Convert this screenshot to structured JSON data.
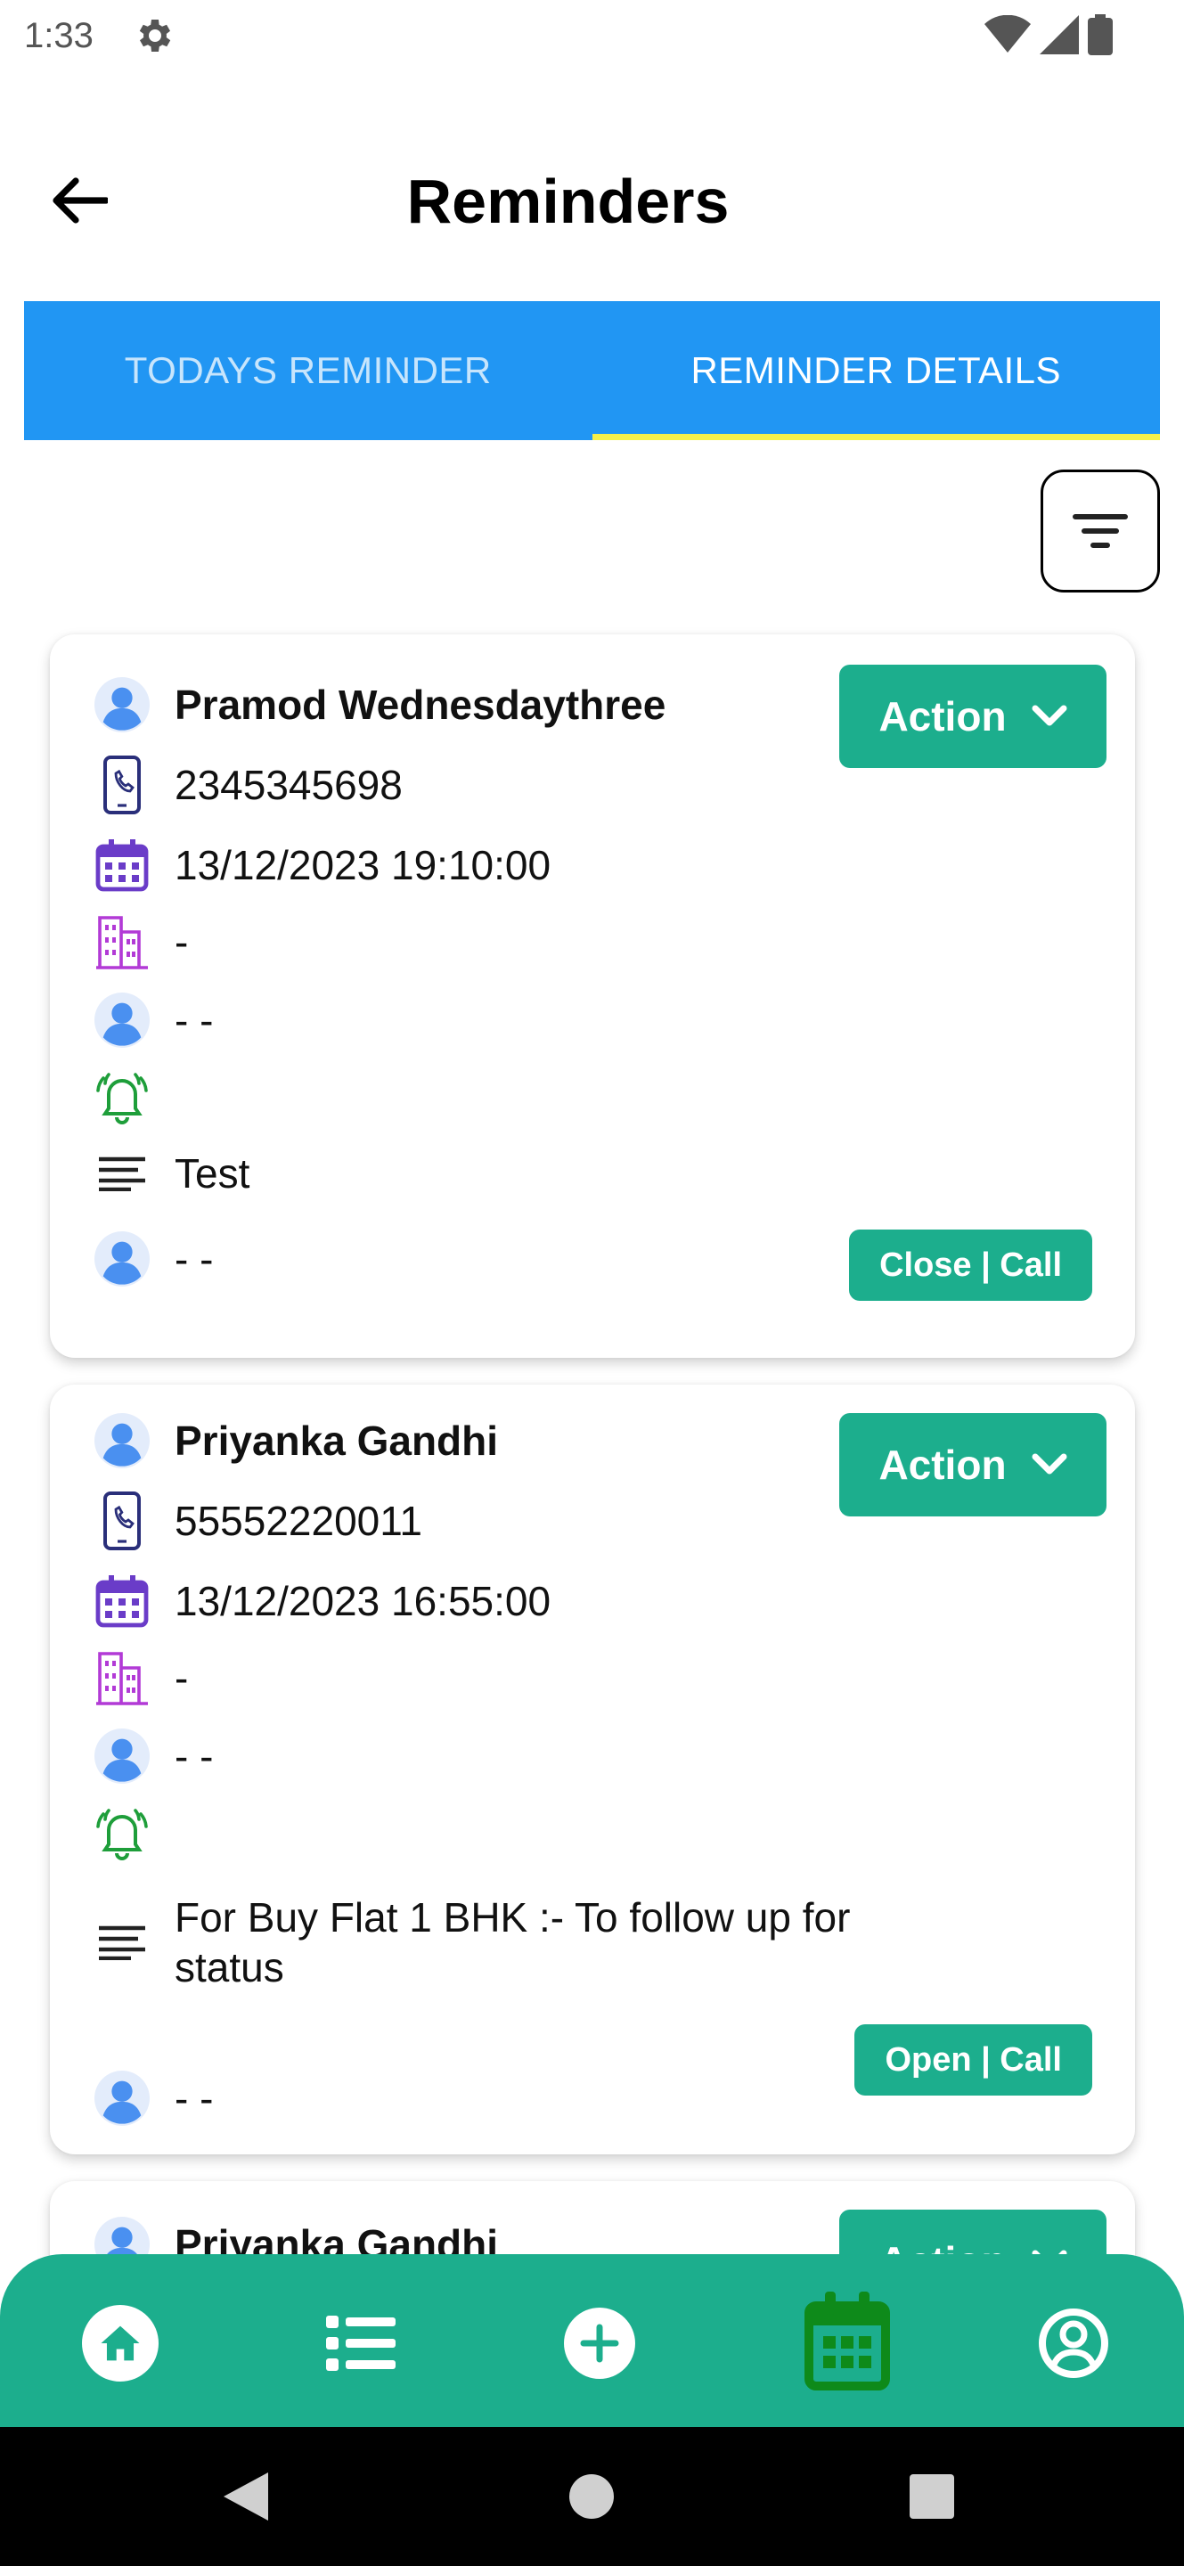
{
  "status_bar": {
    "time": "1:33",
    "icons": [
      "gear-icon",
      "wifi-icon",
      "signal-icon",
      "battery-icon"
    ]
  },
  "header": {
    "title": "Reminders",
    "back_icon": "arrow-left-icon"
  },
  "tabs": [
    {
      "label": "TODAYS REMINDER",
      "active": false
    },
    {
      "label": "REMINDER DETAILS",
      "active": true
    }
  ],
  "filter": {
    "icon": "filter-icon"
  },
  "colors": {
    "tab_bar": "#2196F3",
    "tab_indicator": "#F6F04A",
    "accent": "#1CAE8D",
    "avatar": "#4A90F0",
    "calendar": "#6A3CC8",
    "building": "#B23AD6",
    "bell": "#1E9E3A",
    "phone": "#2A2F7A"
  },
  "reminders": [
    {
      "name": "Pramod Wednesdaythree",
      "phone": "2345345698",
      "datetime": "13/12/2023 19:10:00",
      "project": "-",
      "assignee": "- -",
      "alarm": "",
      "note": "Test",
      "owner": "- -",
      "action_label": "Action",
      "status_label": "Close | Call"
    },
    {
      "name": "Priyanka Gandhi",
      "phone": "55552220011",
      "datetime": "13/12/2023 16:55:00",
      "project": "-",
      "assignee": "- -",
      "alarm": "",
      "note": "For Buy Flat 1 BHK :- To follow up for status",
      "owner": "- -",
      "action_label": "Action",
      "status_label": "Open | Call"
    },
    {
      "name": "Priyanka Gandhi",
      "action_label": "Action"
    }
  ],
  "bottom_nav": [
    {
      "name": "home",
      "icon": "home-icon"
    },
    {
      "name": "list",
      "icon": "list-icon"
    },
    {
      "name": "add",
      "icon": "plus-circle-icon"
    },
    {
      "name": "calendar",
      "icon": "calendar-icon",
      "active": true
    },
    {
      "name": "profile",
      "icon": "user-circle-icon"
    }
  ],
  "system_nav": [
    "back-triangle-icon",
    "home-circle-icon",
    "recents-square-icon"
  ]
}
